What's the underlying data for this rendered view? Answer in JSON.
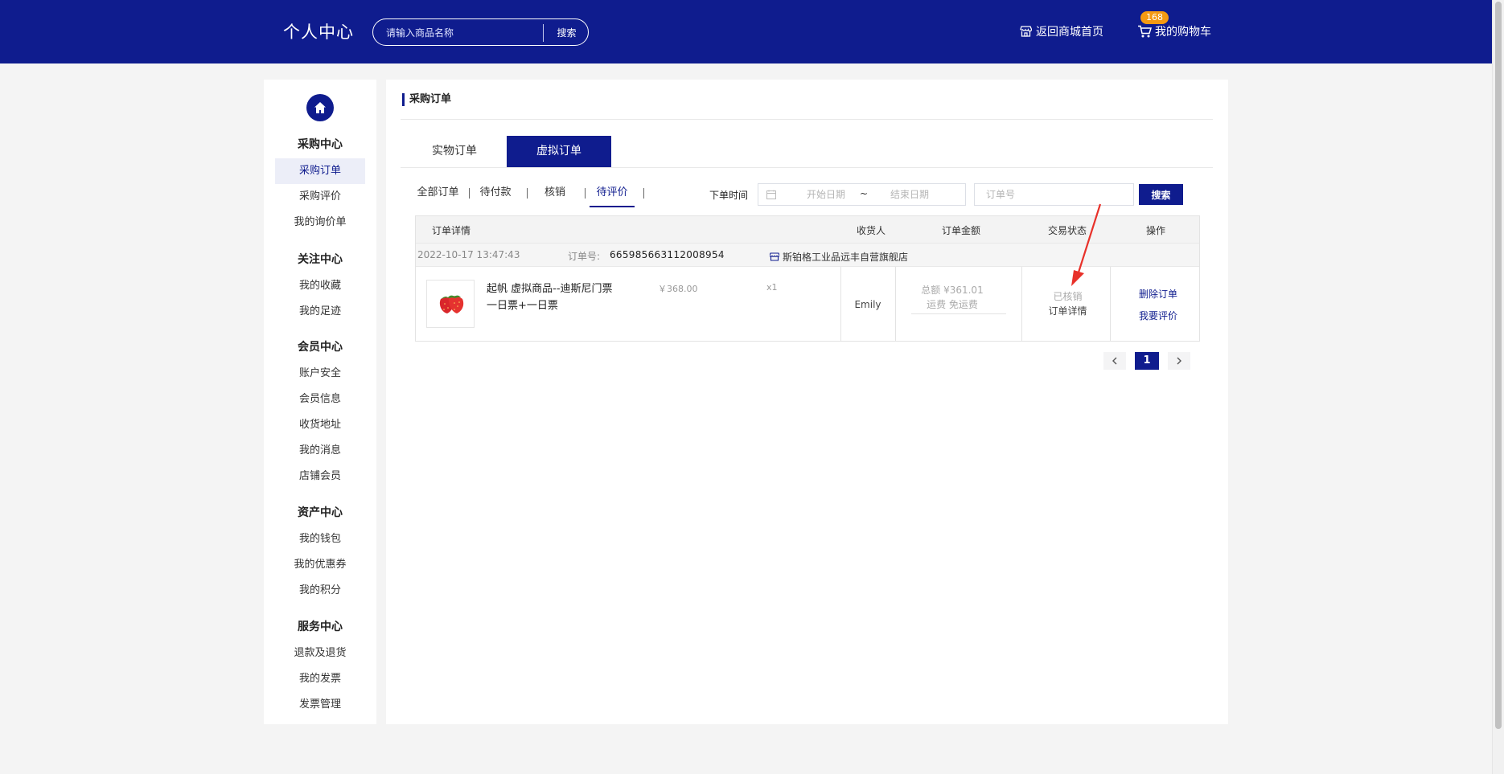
{
  "header": {
    "title": "个人中心",
    "search_placeholder": "请输入商品名称",
    "search_button": "搜索",
    "home_link": "返回商城首页",
    "cart_label": "我的购物车",
    "cart_count": "168"
  },
  "sidebar": {
    "groups": [
      {
        "title": "采购中心",
        "items": [
          "采购订单",
          "采购评价",
          "我的询价单"
        ]
      },
      {
        "title": "关注中心",
        "items": [
          "我的收藏",
          "我的足迹"
        ]
      },
      {
        "title": "会员中心",
        "items": [
          "账户安全",
          "会员信息",
          "收货地址",
          "我的消息",
          "店铺会员"
        ]
      },
      {
        "title": "资产中心",
        "items": [
          "我的钱包",
          "我的优惠券",
          "我的积分"
        ]
      },
      {
        "title": "服务中心",
        "items": [
          "退款及退货",
          "我的发票",
          "发票管理"
        ]
      }
    ],
    "active_item": "采购订单"
  },
  "main": {
    "title": "采购订单",
    "type_tabs": [
      "实物订单",
      "虚拟订单"
    ],
    "active_type_tab": "虚拟订单",
    "filter_tabs": [
      "全部订单",
      "待付款",
      "核销",
      "待评价"
    ],
    "active_filter_tab": "待评价",
    "date_label": "下单时间",
    "start_placeholder": "开始日期",
    "end_placeholder": "结束日期",
    "date_separator": "~",
    "order_no_placeholder": "订单号",
    "search_button": "搜索",
    "table": {
      "headers": [
        "订单详情",
        "收货人",
        "订单金额",
        "交易状态",
        "操作"
      ],
      "order": {
        "time": "2022-10-17 13:47:43",
        "order_no_label": "订单号:",
        "order_no": "665985663112008954",
        "shop": "斯铂格工业品远丰自营旗舰店",
        "goods_name": "起帆 虚拟商品--迪斯尼门票 一日票+一日票",
        "price": "￥368.00",
        "qty": "x1",
        "receiver": "Emily",
        "total": "总额 ¥361.01",
        "shipping": "运费 免运费",
        "status": "已核销",
        "status_detail": "订单详情",
        "op_delete": "删除订单",
        "op_review": "我要评价"
      }
    },
    "pagination": {
      "current": "1"
    }
  },
  "colors": {
    "brand": "#0f1c8e",
    "badge": "#f59a12",
    "annotation_arrow": "#e8312a"
  }
}
